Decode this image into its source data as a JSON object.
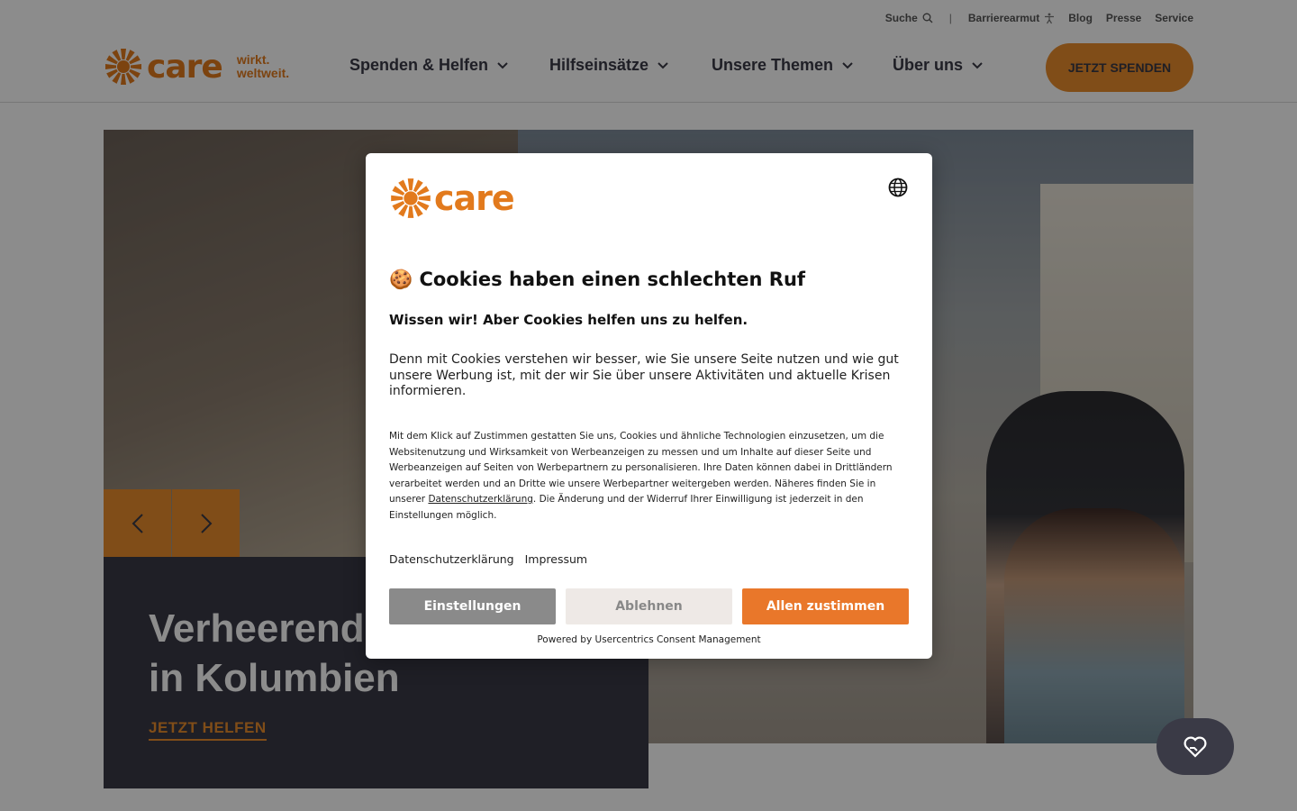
{
  "topbar": {
    "search_label": "Suche",
    "separator": "|",
    "accessibility_label": "Barrierearmut",
    "blog_label": "Blog",
    "press_label": "Presse",
    "service_label": "Service"
  },
  "header": {
    "logo_word": "care",
    "logo_tag_line1": "wirkt.",
    "logo_tag_line2": "weltweit.",
    "nav": [
      {
        "label": "Spenden & Helfen"
      },
      {
        "label": "Hilfseinsätze"
      },
      {
        "label": "Unsere Themen"
      },
      {
        "label": "Über uns"
      }
    ],
    "donate_label": "JETZT SPENDEN"
  },
  "hero": {
    "title": "Verheerendes Erdbeben in Kolumbien",
    "cta_label": "JETZT HELFEN"
  },
  "consent": {
    "logo_word": "care",
    "title": "🍪 Cookies haben einen schlechten Ruf",
    "subtitle": "Wissen wir! Aber Cookies helfen uns zu helfen.",
    "body": "Denn mit Cookies verstehen wir besser, wie Sie unsere Seite nutzen und wie gut unsere Werbung ist, mit der wir Sie über unsere Aktivitäten und aktuelle Krisen informieren.",
    "small_text_before": "Mit dem Klick auf Zustimmen gestatten Sie uns, Cookies und ähnliche Technologien einzusetzen, um die Websitenutzung und Wirksamkeit von Werbeanzeigen zu messen und um Inhalte auf dieser Seite und Werbeanzeigen auf Seiten von Werbepartnern zu personalisieren. Ihre Daten können dabei in Drittländern verarbeitet werden und an Dritte wie unsere Werbepartner weitergeben werden. Näheres finden Sie in unserer ",
    "small_text_link": "Datenschutzerklärung",
    "small_text_after": ". Die Änderung und der Widerruf Ihrer Einwilligung ist jederzeit in den Einstellungen möglich.",
    "link_privacy": "Datenschutzerklärung",
    "link_imprint": "Impressum",
    "btn_settings": "Einstellungen",
    "btn_deny": "Ablehnen",
    "btn_accept": "Allen zustimmen",
    "powered_by": "Powered by Usercentrics Consent Management"
  },
  "colors": {
    "brand_orange": "#e98c2c",
    "dark_navy": "#3a3a46",
    "accept_orange": "#e9772a"
  },
  "icons": [
    "search-icon",
    "accessibility-icon",
    "chevron-down-icon",
    "arrow-left-icon",
    "arrow-right-icon",
    "globe-icon",
    "heart-hand-icon",
    "care-logo-icon"
  ]
}
